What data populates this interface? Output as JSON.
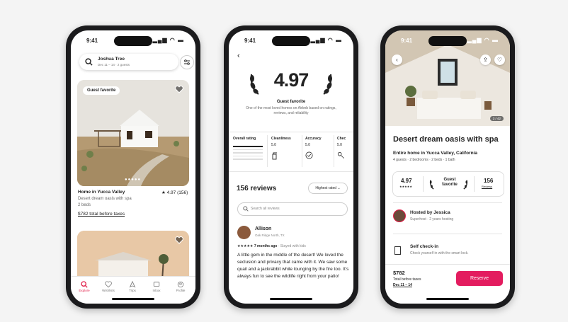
{
  "status": {
    "time": "9:41"
  },
  "phone1": {
    "search_title": "Joshua Tree",
    "search_sub": "Dec 11 – 14 · 2 guests",
    "badge": "Guest favorite",
    "listing_title": "Home in Yucca Valley",
    "listing_rating": "★ 4.97 (156)",
    "listing_desc": "Desert dream oasis with spa",
    "listing_beds": "2 beds",
    "listing_price": "$782 total before taxes",
    "tabs": [
      "Explore",
      "Wishlists",
      "Trips",
      "Inbox",
      "Profile"
    ]
  },
  "phone2": {
    "score": "4.97",
    "guest_favorite": "Guest favorite",
    "description": "One of the most loved homes on Airbnb based on ratings, reviews, and reliability",
    "stats": [
      {
        "label": "Overall rating",
        "value": ""
      },
      {
        "label": "Cleanliness",
        "value": "5.0"
      },
      {
        "label": "Accuracy",
        "value": "5.0"
      },
      {
        "label": "Chec",
        "value": "5.0"
      }
    ],
    "reviews_count": "156 reviews",
    "sort": "Highest rated",
    "search_placeholder": "Search all reviews",
    "reviewer_name": "Allison",
    "reviewer_loc": "Oak Ridge North, TX",
    "review_meta": "7 months ago",
    "review_meta2": "· Stayed with kids",
    "review_stars": "★★★★★",
    "review_text": "A little gem in the middle of the desert! We loved the seclusion and privacy that came with it. We saw some quail and a jackrabbit while lounging by the fire too. It's always fun to see the wildlife right from your patio!"
  },
  "phone3": {
    "photo_count": "3 / 42",
    "title": "Desert dream oasis with spa",
    "subtitle": "Entire home in Yucca Valley, California",
    "details": "4 guests · 2 bedrooms · 2 beds · 1 bath",
    "rating": "4.97",
    "rating_stars": "★★★★★",
    "guest_favorite": "Guest favorite",
    "reviews_num": "156",
    "reviews_label": "Reviews",
    "host": "Hosted by Jessica",
    "host_sub": "Superhost · 2 years hosting",
    "checkin": "Self check-in",
    "checkin_sub": "Check yourself in with the smart lock.",
    "price": "$782",
    "price_sub": "Total before taxes",
    "dates": "Dec 11 – 14",
    "reserve": "Reserve"
  },
  "colors": {
    "brand": "#e31c5f",
    "active_tab": "#e11d48"
  }
}
